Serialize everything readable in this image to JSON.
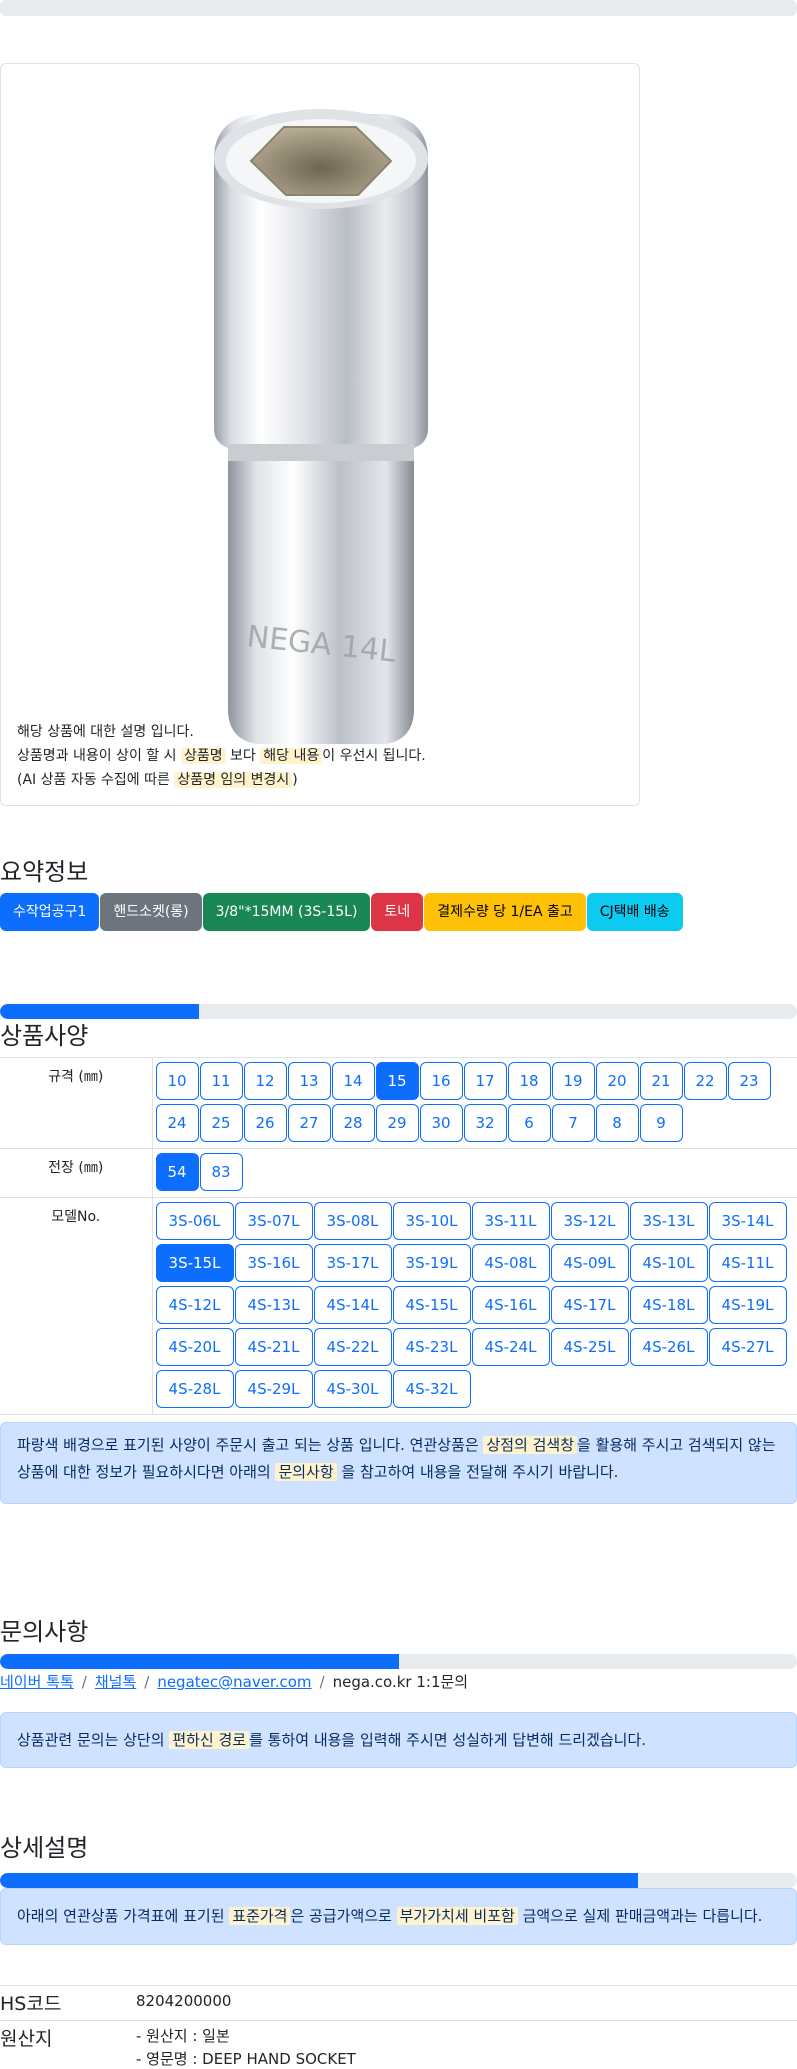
{
  "product_description": {
    "line1": "해당 상품에 대한 설명 입니다.",
    "line2_a": "상품명과 내용이 상이 할 시 ",
    "line2_mark1": "상품명",
    "line2_b": " 보다 ",
    "line2_mark2": "해당 내용",
    "line2_c": "이 우선시 됩니다.",
    "line3_a": "(AI 상품 자동 수집에 따른 ",
    "line3_mark": "상품명 임의 변경시",
    "line3_b": ")"
  },
  "summary": {
    "title": "요약정보",
    "badges": [
      {
        "label": "수작업공구1",
        "color": "#0d6efd"
      },
      {
        "label": "핸드소켓(롱)",
        "color": "#6c757d"
      },
      {
        "label": "3/8\"*15MM (3S-15L)",
        "color": "#198754"
      },
      {
        "label": "토네",
        "color": "#dc3545"
      },
      {
        "label": "결제수량 당 1/EA 출고",
        "color": "#ffc107"
      },
      {
        "label": "CJ택배 배송",
        "color": "#0dcaf0"
      }
    ]
  },
  "spec": {
    "title": "상품사양",
    "progress_percent": 25,
    "rows": [
      {
        "label": "규격 (㎜)",
        "options": [
          "10",
          "11",
          "12",
          "13",
          "14",
          "15",
          "16",
          "17",
          "18",
          "19",
          "20",
          "21",
          "22",
          "23",
          "24",
          "25",
          "26",
          "27",
          "28",
          "29",
          "30",
          "32",
          "6",
          "7",
          "8",
          "9"
        ],
        "selected": "15"
      },
      {
        "label": "전장 (㎜)",
        "options": [
          "54",
          "83"
        ],
        "selected": "54"
      },
      {
        "label": "모델No.",
        "options": [
          "3S-06L",
          "3S-07L",
          "3S-08L",
          "3S-10L",
          "3S-11L",
          "3S-12L",
          "3S-13L",
          "3S-14L",
          "3S-15L",
          "3S-16L",
          "3S-17L",
          "3S-19L",
          "4S-08L",
          "4S-09L",
          "4S-10L",
          "4S-11L",
          "4S-12L",
          "4S-13L",
          "4S-14L",
          "4S-15L",
          "4S-16L",
          "4S-17L",
          "4S-18L",
          "4S-19L",
          "4S-20L",
          "4S-21L",
          "4S-22L",
          "4S-23L",
          "4S-24L",
          "4S-25L",
          "4S-26L",
          "4S-27L",
          "4S-28L",
          "4S-29L",
          "4S-30L",
          "4S-32L"
        ],
        "selected": "3S-15L"
      }
    ],
    "notice_a": "파랑색 배경으로 표기된 사양이 주문시 출고 되는 상품 입니다. 연관상품은 ",
    "notice_mark1": "상점의 검색창",
    "notice_b": "을 활용해 주시고 검색되지 않는 상품에 대한 정보가 필요하시다면 아래의 ",
    "notice_mark2": "문의사항",
    "notice_c": " 을 참고하여 내용을 전달해 주시기 바랍니다."
  },
  "inquiry": {
    "title": "문의사항",
    "progress_percent": 50,
    "links": [
      "네이버 톡톡",
      "채널톡",
      "negatec@naver.com"
    ],
    "last_crumb": "nega.co.kr 1:1문의",
    "notice_a": "상품관련 문의는 상단의 ",
    "notice_mark": "편하신 경로",
    "notice_b": "를 통하여 내용을 입력해 주시면 성실하게 답변해 드리겠습니다."
  },
  "detail": {
    "title": "상세설명",
    "progress_percent": 80,
    "notice_a": "아래의 연관상품 가격표에 표기된 ",
    "notice_mark1": "표준가격",
    "notice_b": "은 공급가액으로 ",
    "notice_mark2": "부가가치세 비포함",
    "notice_c": " 금액으로 실제 판매금액과는 다릅니다.",
    "hs_label": "HS코드",
    "hs_value": "8204200000",
    "origin_label": "원산지",
    "origin_line1": "- 원산지 : 일본",
    "origin_line2": "- 영문명 : DEEP HAND SOCKET"
  }
}
